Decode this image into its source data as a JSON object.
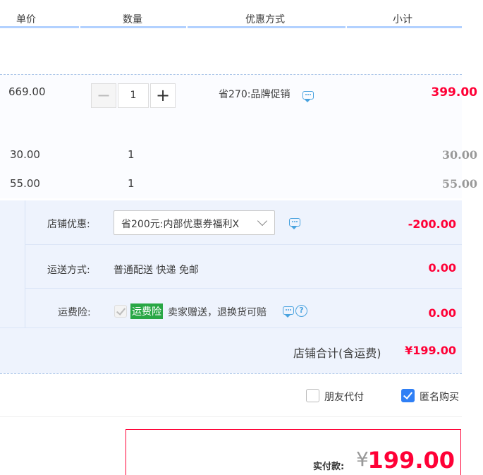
{
  "header": {
    "columns": [
      "单价",
      "数量",
      "优惠方式",
      "小计"
    ]
  },
  "items": [
    {
      "price": "669.00",
      "quantity": "1",
      "promo": "省270:品牌促销",
      "subtotal": "399.00"
    },
    {
      "price": "30.00",
      "quantity": "1",
      "subtotal": "30.00"
    },
    {
      "price": "55.00",
      "quantity": "1",
      "subtotal": "55.00"
    }
  ],
  "stepper": {
    "minus": "−",
    "plus": "+"
  },
  "shop": {
    "discount_label": "店铺优惠:",
    "discount_selected": "省200元:内部优惠券福利X",
    "discount_amount": "-200.00",
    "shipping_label": "运送方式:",
    "shipping_value": "普通配送 快递 免邮",
    "shipping_amount": "0.00",
    "insurance_label": "运费险:",
    "insurance_tag": "运费险",
    "insurance_text": "卖家赠送，退换货可赔",
    "insurance_amount": "0.00",
    "help_glyph": "?",
    "total_label": "店铺合计(含运费)",
    "total_value": "¥199.00"
  },
  "options": {
    "friend_pay": "朋友代付",
    "anonymous": "匿名购买",
    "friend_pay_checked": false,
    "anonymous_checked": true
  },
  "payment": {
    "label": "实付款:",
    "currency": "¥",
    "amount": "199.00"
  },
  "colors": {
    "accent_red": "#ff0036",
    "header_bar": "#b2d1ff",
    "shop_bg": "#eef3fd",
    "insurance_green": "#29a745",
    "checkbox_blue": "#2f7ff5"
  }
}
